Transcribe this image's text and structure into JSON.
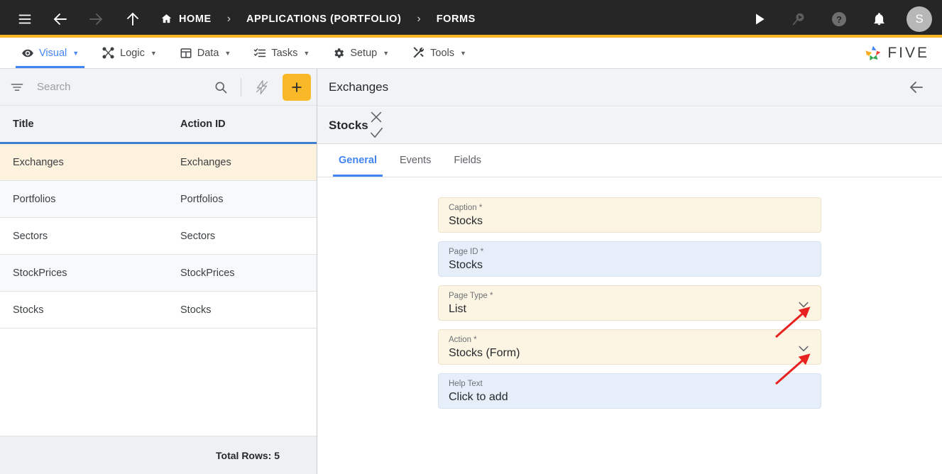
{
  "topbar": {
    "icons": [
      {
        "name": "hamburger-menu-icon",
        "label": "menu"
      },
      {
        "name": "back-arrow-icon",
        "label": "back"
      },
      {
        "name": "forward-arrow-icon",
        "label": "forward"
      },
      {
        "name": "up-arrow-icon",
        "label": "up"
      }
    ],
    "breadcrumbs": [
      {
        "label": "HOME",
        "icon": "home-icon"
      },
      {
        "label": "APPLICATIONS (PORTFOLIO)",
        "icon": ""
      },
      {
        "label": "FORMS",
        "icon": ""
      }
    ],
    "separator": "›",
    "right_icons": [
      {
        "name": "run-play-icon",
        "label": "run"
      },
      {
        "name": "search-run-icon",
        "label": "debug"
      },
      {
        "name": "help-icon",
        "label": "help"
      },
      {
        "name": "notifications-bell-icon",
        "label": "notifications"
      }
    ],
    "avatar_initial": "S",
    "bg_color": "#262626",
    "accent_color": "#f9b424"
  },
  "menubar": {
    "items": [
      {
        "label": "Visual",
        "icon": "eye-icon",
        "caret": "▼",
        "active": true
      },
      {
        "label": "Logic",
        "icon": "logic-nodes-icon",
        "caret": "▼",
        "active": false
      },
      {
        "label": "Data",
        "icon": "table-grid-icon",
        "caret": "▼",
        "active": false
      },
      {
        "label": "Tasks",
        "icon": "tasks-list-icon",
        "caret": "▼",
        "active": false
      },
      {
        "label": "Setup",
        "icon": "gear-icon",
        "caret": "▼",
        "active": false
      },
      {
        "label": "Tools",
        "icon": "tools-wrench-icon",
        "caret": "▼",
        "active": false
      }
    ],
    "logo_text": "FIVE",
    "active_color": "#4285f4"
  },
  "sidebar": {
    "search": {
      "placeholder": "Search",
      "value": "",
      "filter_icon": "filter-icon",
      "search_icon": "search-icon",
      "bolt_icon": "lightning-bolt-disabled-icon",
      "add_label": "+"
    },
    "table": {
      "columns": [
        "Title",
        "Action ID"
      ],
      "rows": [
        {
          "title": "Exchanges",
          "action_id": "Exchanges",
          "selected": true
        },
        {
          "title": "Portfolios",
          "action_id": "Portfolios",
          "selected": false
        },
        {
          "title": "Sectors",
          "action_id": "Sectors",
          "selected": false
        },
        {
          "title": "StockPrices",
          "action_id": "StockPrices",
          "selected": false
        },
        {
          "title": "Stocks",
          "action_id": "Stocks",
          "selected": false
        }
      ],
      "footer": "Total Rows: 5",
      "selected_row_color": "#fdf2dd",
      "header_underline_color": "#3f7fd0"
    }
  },
  "detail": {
    "header": {
      "title": "Exchanges",
      "back_icon": "back-arrow-icon"
    },
    "subheader": {
      "title": "Stocks",
      "cancel_icon": "close-x-icon",
      "save_icon": "check-icon"
    },
    "tabs": [
      {
        "label": "General",
        "active": true
      },
      {
        "label": "Events",
        "active": false
      },
      {
        "label": "Fields",
        "active": false
      }
    ],
    "fields": [
      {
        "label": "Caption *",
        "value": "Stocks",
        "style": "cream",
        "dropdown": false,
        "name": "caption-field"
      },
      {
        "label": "Page ID *",
        "value": "Stocks",
        "style": "blue",
        "dropdown": false,
        "name": "page-id-field"
      },
      {
        "label": "Page Type *",
        "value": "List",
        "style": "cream",
        "dropdown": true,
        "name": "page-type-field"
      },
      {
        "label": "Action *",
        "value": "Stocks (Form)",
        "style": "cream",
        "dropdown": true,
        "name": "action-field"
      },
      {
        "label": "Help Text",
        "value": "Click to add",
        "style": "blue",
        "dropdown": false,
        "name": "help-text-field"
      }
    ],
    "annotations": {
      "color": "#e8231f",
      "arrows": [
        {
          "target": "page-type-dropdown-chevron"
        },
        {
          "target": "action-dropdown-chevron"
        }
      ]
    }
  }
}
